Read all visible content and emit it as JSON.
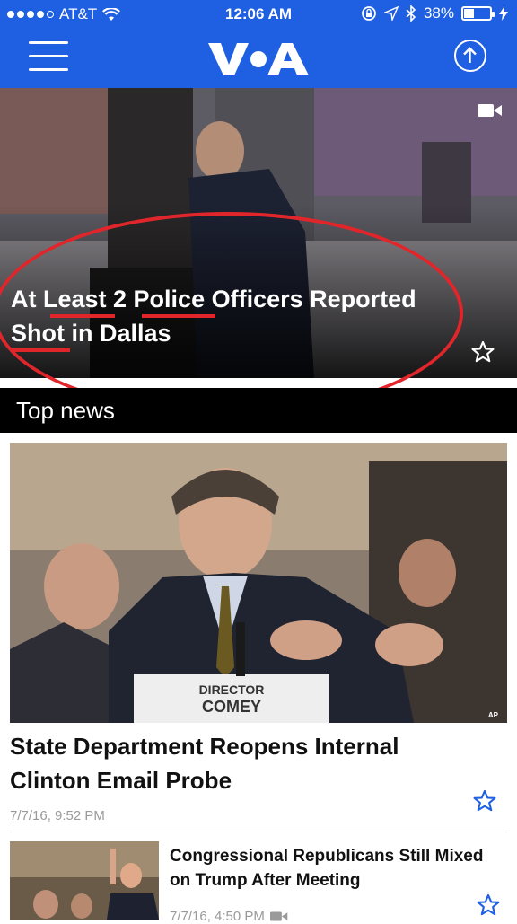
{
  "status_bar": {
    "carrier": "AT&T",
    "time": "12:06 AM",
    "battery_percent": "38%"
  },
  "header": {
    "logo_text": "VOA",
    "menu_icon": "hamburger-menu-icon",
    "up_icon": "arrow-up-circle-icon",
    "brand_color": "#1f5fe2"
  },
  "hero": {
    "headline": "At Least 2 Police Officers Reported Shot in Dallas",
    "media_icon": "video-camera-icon",
    "favorite_icon": "star-outline-icon",
    "annotation_color": "#e0262a"
  },
  "section": {
    "title": "Top news"
  },
  "top_story": {
    "title": "State Department Reopens Internal Clinton Email Probe",
    "date": "7/7/16, 9:52 PM",
    "image_caption_nameplate_line1": "DIRECTOR",
    "image_caption_nameplate_line2": "COMEY",
    "image_credit": "AP",
    "favorite_icon": "star-outline-icon"
  },
  "list_items": [
    {
      "title": "Congressional Republicans Still Mixed on Trump After Meeting",
      "date": "7/7/16, 4:50 PM",
      "media_icon": "video-camera-icon",
      "favorite_icon": "star-outline-icon"
    }
  ]
}
